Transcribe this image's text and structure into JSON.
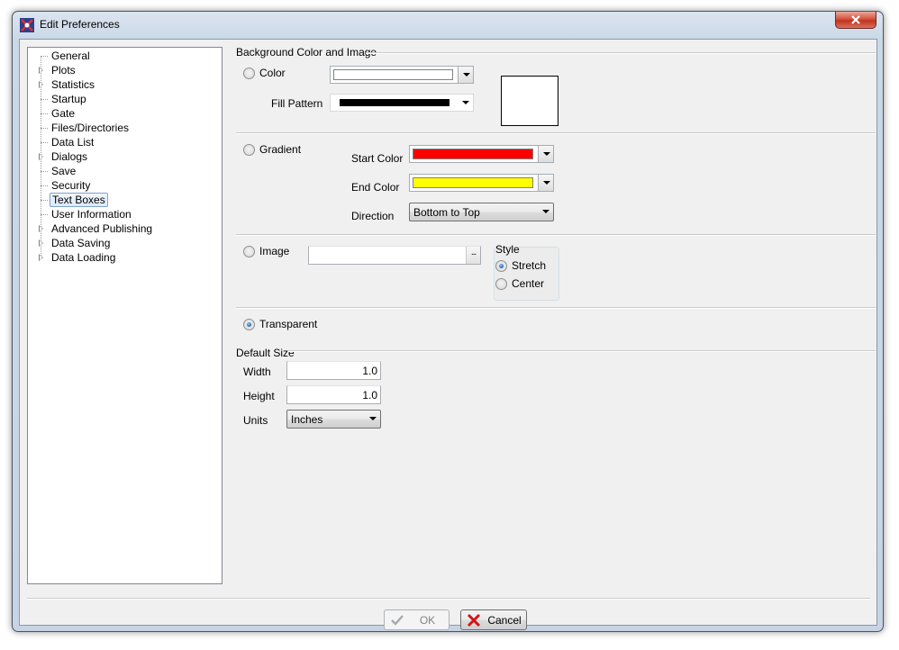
{
  "window": {
    "title": "Edit Preferences"
  },
  "tree": {
    "items": [
      {
        "label": "General",
        "expandable": false,
        "selected": false
      },
      {
        "label": "Plots",
        "expandable": true,
        "selected": false
      },
      {
        "label": "Statistics",
        "expandable": true,
        "selected": false
      },
      {
        "label": "Startup",
        "expandable": false,
        "selected": false
      },
      {
        "label": "Gate",
        "expandable": false,
        "selected": false
      },
      {
        "label": "Files/Directories",
        "expandable": false,
        "selected": false
      },
      {
        "label": "Data List",
        "expandable": false,
        "selected": false
      },
      {
        "label": "Dialogs",
        "expandable": true,
        "selected": false
      },
      {
        "label": "Save",
        "expandable": false,
        "selected": false
      },
      {
        "label": "Security",
        "expandable": false,
        "selected": false
      },
      {
        "label": "Text Boxes",
        "expandable": false,
        "selected": true
      },
      {
        "label": "User Information",
        "expandable": false,
        "selected": false
      },
      {
        "label": "Advanced Publishing",
        "expandable": true,
        "selected": false
      },
      {
        "label": "Data Saving",
        "expandable": true,
        "selected": false
      },
      {
        "label": "Data Loading",
        "expandable": true,
        "selected": false
      }
    ]
  },
  "background": {
    "caption": "Background Color and Image",
    "color": {
      "label": "Color",
      "checked": false,
      "swatch": "#ffffff"
    },
    "fill_pattern": {
      "label": "Fill Pattern",
      "swatch": "#000000"
    },
    "preview_color": "#ffffff",
    "gradient": {
      "label": "Gradient",
      "checked": false,
      "start_label": "Start Color",
      "start_color": "#ff0000",
      "end_label": "End Color",
      "end_color": "#ffff00",
      "direction_label": "Direction",
      "direction_value": "Bottom to Top"
    },
    "image": {
      "label": "Image",
      "checked": false,
      "path": "",
      "browse_label": "...",
      "style_caption": "Style",
      "stretch_label": "Stretch",
      "stretch_checked": true,
      "center_label": "Center",
      "center_checked": false
    },
    "transparent": {
      "label": "Transparent",
      "checked": true
    }
  },
  "default_size": {
    "caption": "Default Size",
    "width_label": "Width",
    "width_value": "1.0",
    "height_label": "Height",
    "height_value": "1.0",
    "units_label": "Units",
    "units_value": "Inches"
  },
  "buttons": {
    "ok": {
      "label": "OK",
      "icon": "checkmark-icon",
      "enabled": false
    },
    "cancel": {
      "label": "Cancel",
      "icon": "red-x-icon",
      "enabled": true
    }
  }
}
